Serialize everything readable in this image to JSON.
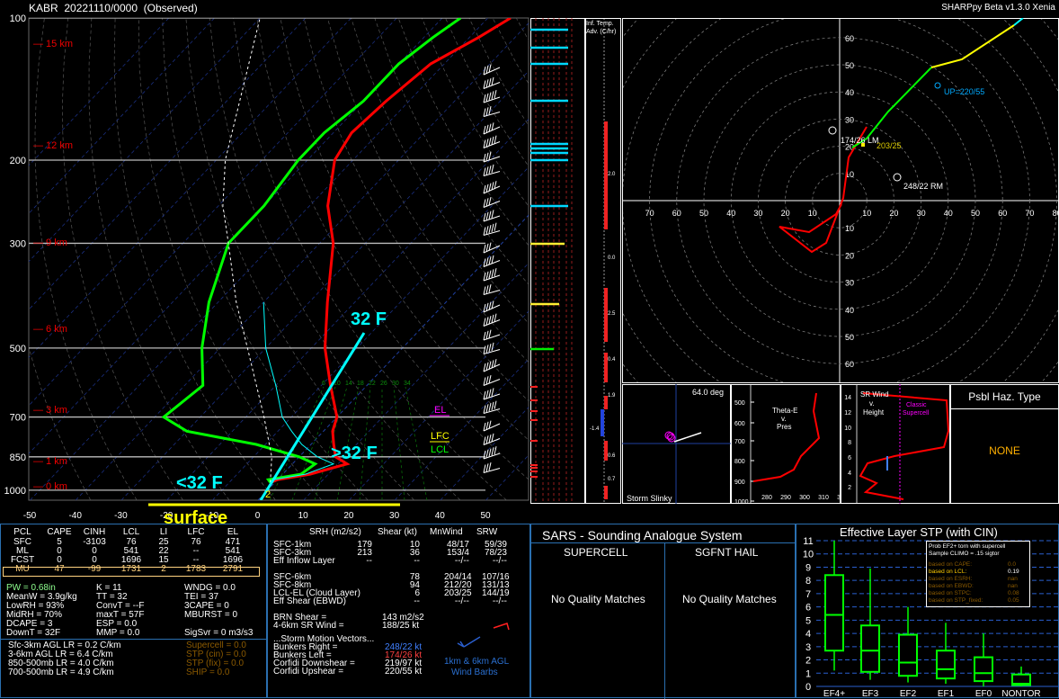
{
  "header": {
    "station": "KABR",
    "datetime": "20221110/0000",
    "status": "(Observed)",
    "app": "SHARPpy Beta v1.3.0 Xenia"
  },
  "skewt": {
    "pressure_labels": [
      "100",
      "200",
      "300",
      "500",
      "700",
      "850",
      "1000"
    ],
    "height_labels": [
      "15 km",
      "12 km",
      "9 km",
      "6 km",
      "3 km",
      "1 km",
      "0 km"
    ],
    "temp_labels": [
      "-50",
      "-40",
      "-30",
      "-20",
      "-10",
      "0",
      "10",
      "20",
      "30",
      "40",
      "50"
    ],
    "mixing_labels": [
      "6",
      "10",
      "14",
      "18",
      "22",
      "26",
      "30",
      "34"
    ],
    "annotations": {
      "el": "EL",
      "lfc": "LFC",
      "lcl": "LCL",
      "f32": "32 F",
      "above32": ">32 F",
      "below32": "<32 F",
      "surface": "surface",
      "sfc_val": "2"
    },
    "colors": {
      "temp": "#ff0000",
      "dewpoint": "#00ff00",
      "wetbulb": "#00ffff",
      "isotherm": "#00ffff",
      "parcel": "#ffffff"
    }
  },
  "chart_data": {
    "type": "line",
    "title": "",
    "xlabel": "",
    "ylabel": "",
    "ylim": [
      1000,
      100
    ],
    "xlim": [
      -50,
      50
    ],
    "series": [
      {
        "name": "",
        "x": [
          -1,
          0,
          6,
          12,
          8,
          5,
          2,
          0,
          -8,
          -17,
          -26,
          -37,
          -46,
          -54,
          -56,
          -55,
          -53,
          -48,
          -45
        ],
        "y": [
          963,
          950,
          925,
          880,
          850,
          800,
          750,
          700,
          600,
          500,
          400,
          300,
          250,
          200,
          175,
          150,
          125,
          110,
          100
        ]
      },
      {
        "name": "",
        "x": [
          -1,
          -2,
          4,
          5,
          0,
          -12,
          -30,
          -38,
          -36,
          -44,
          -52,
          -60,
          -60,
          -62,
          -62,
          -60,
          -60,
          -58,
          -56
        ],
        "y": [
          963,
          950,
          925,
          880,
          850,
          800,
          750,
          700,
          600,
          500,
          400,
          300,
          250,
          200,
          175,
          150,
          125,
          110,
          100
        ]
      }
    ]
  },
  "inferred_temp_adv": {
    "title_1": "Inf. Temp.",
    "title_2": "Adv. (C/hr)",
    "labels": [
      "2.0",
      "0.0",
      "2.5",
      "0.4",
      "1.9",
      "-1.4",
      "0.6",
      "0.7"
    ]
  },
  "hodograph": {
    "rings": [
      "60",
      "50",
      "40",
      "30",
      "20",
      "10"
    ],
    "x_ticks": [
      "70",
      "60",
      "50",
      "40",
      "30",
      "20",
      "10",
      "10",
      "20",
      "30",
      "40",
      "50",
      "60",
      "70",
      "80"
    ],
    "labels": {
      "up": "UP=220/55",
      "lm": "174/26 LM",
      "dn": "203/25",
      "rm": "248/22 RM"
    }
  },
  "storm_slinky": {
    "angle": "64.0 deg",
    "title": "Storm Slinky"
  },
  "theta_e": {
    "title_1": "Theta-E",
    "title_2": "v.",
    "title_3": "Pres",
    "p_labels": [
      "500",
      "600",
      "700",
      "800",
      "900",
      "1000"
    ],
    "t_labels": [
      "280",
      "290",
      "300",
      "310",
      "320"
    ]
  },
  "sr_wind": {
    "title_1": "SR Wind",
    "title_2": "v.",
    "title_3": "Height",
    "classic_1": "Classic",
    "classic_2": "Supercell",
    "h_labels": [
      "14",
      "12",
      "10",
      "8",
      "6",
      "4",
      "2"
    ]
  },
  "hazard": {
    "title": "Psbl Haz. Type",
    "value": "NONE"
  },
  "thermo": {
    "headers": [
      "PCL",
      "CAPE",
      "CINH",
      "LCL",
      "LI",
      "LFC",
      "EL"
    ],
    "rows": [
      [
        "SFC",
        "5",
        "-3103",
        "76",
        "25",
        "76",
        "471"
      ],
      [
        "ML",
        "0",
        "0",
        "541",
        "22",
        "--",
        "541"
      ],
      [
        "FCST",
        "0",
        "0",
        "1696",
        "15",
        "--",
        "1696"
      ],
      [
        "MU",
        "47",
        "-99",
        "1731",
        "2",
        "1783",
        "2791"
      ]
    ],
    "col1": [
      "PW = 0.68in",
      "MeanW = 3.9g/kg",
      "LowRH = 93%",
      "MidRH = 70%",
      "DCAPE = 3",
      "DownT = 32F"
    ],
    "col2": [
      "K = 11",
      "TT = 32",
      "ConvT = --F",
      "maxT = 57F",
      "ESP = 0.0",
      "MMP = 0.0"
    ],
    "col3": [
      "WNDG = 0.0",
      "TEI = 37",
      "3CAPE = 0",
      "MBURST = 0",
      "",
      "SigSvr = 0 m3/s3"
    ],
    "lapse": [
      "Sfc-3km AGL LR = 0.2 C/km",
      "3-6km AGL LR = 6.4 C/km",
      "850-500mb LR = 4.0 C/km",
      "700-500mb LR = 4.9 C/km"
    ],
    "composite": [
      "Supercell = 0.0",
      "STP (cin) = 0.0",
      "STP (fix) = 0.0",
      "SHIP = 0.0"
    ]
  },
  "kinematic": {
    "headers": [
      "SRH (m2/s2)",
      "Shear (kt)",
      "MnWind",
      "SRW"
    ],
    "rows": [
      [
        "SFC-1km",
        "179",
        "10",
        "48/17",
        "59/39"
      ],
      [
        "SFC-3km",
        "213",
        "36",
        "153/4",
        "78/23"
      ],
      [
        "Eff Inflow Layer",
        "--",
        "--",
        "--/--",
        "--/--"
      ],
      [
        "",
        "",
        "",
        "",
        ""
      ],
      [
        "SFC-6km",
        "",
        "78",
        "204/14",
        "107/16"
      ],
      [
        "SFC-8km",
        "",
        "94",
        "212/20",
        "131/13"
      ],
      [
        "LCL-EL (Cloud Layer)",
        "",
        "6",
        "203/25",
        "144/19"
      ],
      [
        "Eff Shear (EBWD)",
        "",
        "--",
        "--/--",
        "--/--"
      ]
    ],
    "brn_shear": "BRN Shear =",
    "brn_val": "143 m2/s2",
    "sr46": "4-6km SR Wind =",
    "sr46_val": "188/25 kt",
    "motion_title": "...Storm Motion Vectors...",
    "motion_labels": [
      "Bunkers Right =",
      "Bunkers Left =",
      "Corfidi Downshear =",
      "Corfidi Upshear ="
    ],
    "motion_vals": [
      "248/22 kt",
      "174/26 kt",
      "219/97 kt",
      "220/55 kt"
    ],
    "barb_label_1": "1km & 6km AGL",
    "barb_label_2": "Wind Barbs"
  },
  "sars": {
    "title": "SARS - Sounding Analogue System",
    "supercell": "SUPERCELL",
    "hail": "SGFNT HAIL",
    "sc_result": "No Quality Matches",
    "hail_result": "No Quality Matches"
  },
  "stp": {
    "title": "Effective Layer STP (with CIN)",
    "y_labels": [
      "11",
      "10",
      "9",
      "8",
      "7",
      "6",
      "5",
      "4",
      "3",
      "2",
      "1",
      "0"
    ],
    "categories": [
      "EF4+",
      "EF3",
      "EF2",
      "EF1",
      "EF0",
      "NONTOR"
    ],
    "box_data": [
      {
        "lo": 1.2,
        "q1": 2.7,
        "med": 5.4,
        "q3": 8.4,
        "hi": 11
      },
      {
        "lo": 0.5,
        "q1": 1.1,
        "med": 2.7,
        "q3": 4.6,
        "hi": 8.9
      },
      {
        "lo": 0.3,
        "q1": 0.8,
        "med": 1.8,
        "q3": 3.9,
        "hi": 6.0
      },
      {
        "lo": 0.2,
        "q1": 0.6,
        "med": 1.3,
        "q3": 2.7,
        "hi": 4.8
      },
      {
        "lo": 0,
        "q1": 0.4,
        "med": 1.0,
        "q3": 2.2,
        "hi": 4.0
      },
      {
        "lo": 0,
        "q1": 0.1,
        "med": 0.2,
        "q3": 0.9,
        "hi": 1.5
      }
    ],
    "legend_title_1": "Prob EF2+ torn with supercell",
    "legend_title_2": "Sample CLIMO = .15 sigtor",
    "legend_rows": [
      [
        "based on CAPE:",
        "0.0"
      ],
      [
        "based on LCL:",
        "0.19"
      ],
      [
        "based on ESRH:",
        "nan"
      ],
      [
        "based on EBWD:",
        "nan"
      ],
      [
        "based on STPC:",
        "0.08"
      ],
      [
        "based on STP_fixed:",
        "0.05"
      ]
    ]
  }
}
